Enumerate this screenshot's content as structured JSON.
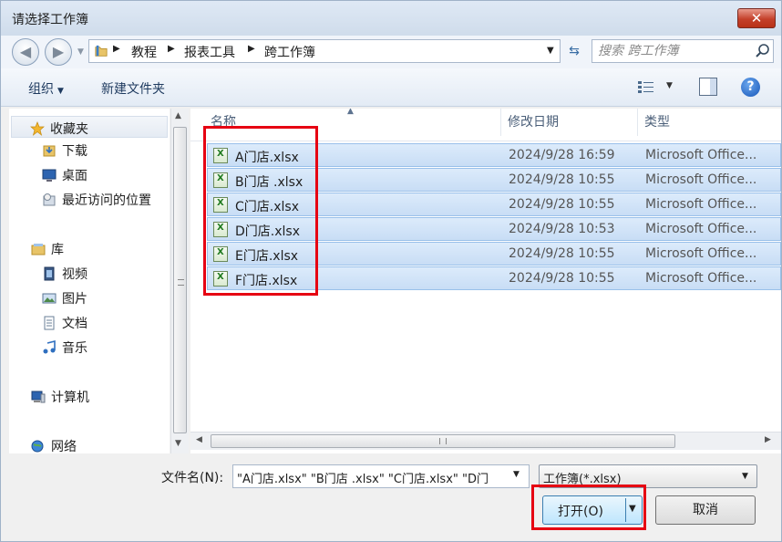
{
  "window": {
    "title": "请选择工作簿",
    "close_label": "✕"
  },
  "nav": {
    "back_icon": "back-arrow-icon",
    "forward_icon": "forward-arrow-icon",
    "breadcrumb": [
      "教程",
      "报表工具",
      "跨工作簿"
    ],
    "search_placeholder": "搜索 跨工作簿"
  },
  "toolbar": {
    "organize_label": "组织",
    "new_folder_label": "新建文件夹"
  },
  "sidebar": {
    "favorites": {
      "label": "收藏夹",
      "items": [
        "下载",
        "桌面",
        "最近访问的位置"
      ]
    },
    "libraries": {
      "label": "库",
      "items": [
        "视频",
        "图片",
        "文档",
        "音乐"
      ]
    },
    "computer_label": "计算机",
    "network_label": "网络"
  },
  "columns": {
    "name": "名称",
    "date": "修改日期",
    "type": "类型"
  },
  "files": [
    {
      "name": "A门店.xlsx",
      "date": "2024/9/28 16:59",
      "type": "Microsoft Office..."
    },
    {
      "name": "B门店 .xlsx",
      "date": "2024/9/28 10:55",
      "type": "Microsoft Office..."
    },
    {
      "name": "C门店.xlsx",
      "date": "2024/9/28 10:55",
      "type": "Microsoft Office..."
    },
    {
      "name": "D门店.xlsx",
      "date": "2024/9/28 10:53",
      "type": "Microsoft Office..."
    },
    {
      "name": "E门店.xlsx",
      "date": "2024/9/28 10:55",
      "type": "Microsoft Office..."
    },
    {
      "name": "F门店.xlsx",
      "date": "2024/9/28 10:55",
      "type": "Microsoft Office..."
    }
  ],
  "footer": {
    "filename_label": "文件名(N):",
    "filename_value": "\"A门店.xlsx\" \"B门店 .xlsx\" \"C门店.xlsx\" \"D门",
    "filetype_value": "工作簿(*.xlsx)",
    "open_label": "打开(O)",
    "cancel_label": "取消"
  },
  "colors": {
    "highlight": "#e60012",
    "selection": "#cce4f7",
    "close": "#c4402a"
  }
}
